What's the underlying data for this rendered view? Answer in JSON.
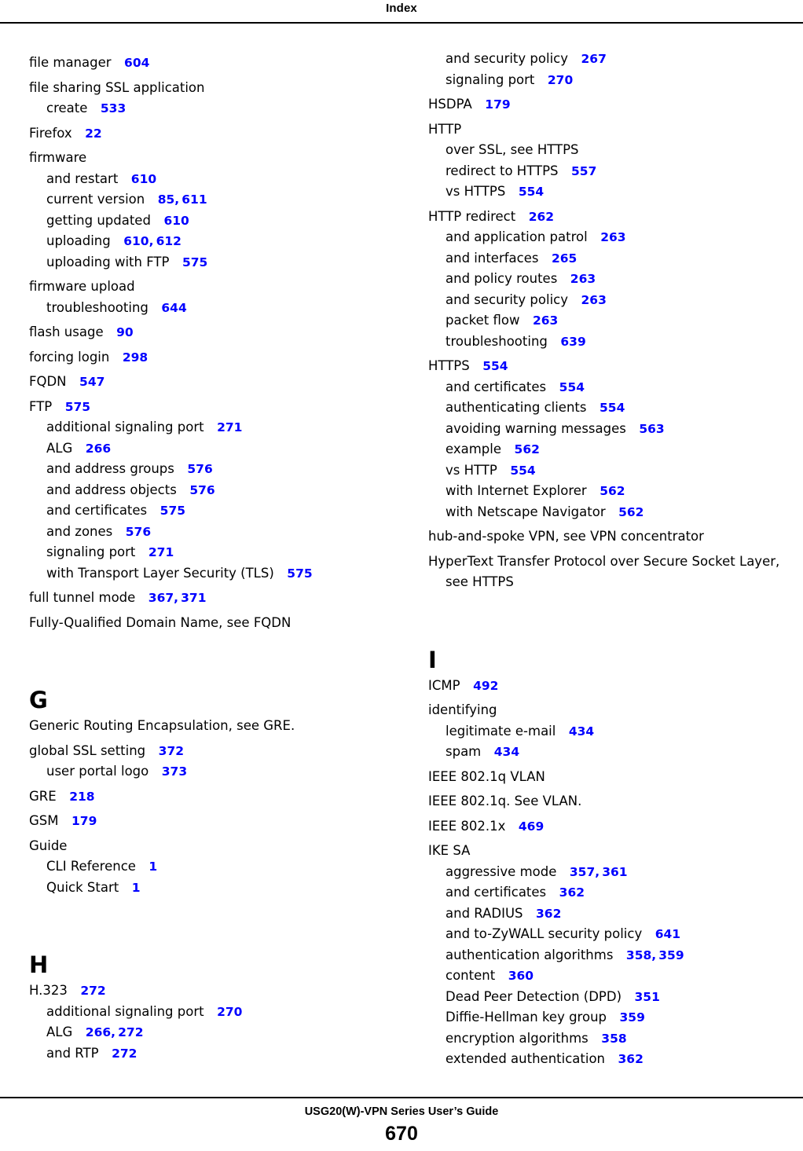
{
  "header": {
    "title": "Index"
  },
  "footer": {
    "guide_title": "USG20(W)-VPN Series User’s Guide",
    "page_number": "670"
  },
  "colors": {
    "page_ref": "#0000ff",
    "text": "#000000",
    "background": "#ffffff"
  },
  "columns": [
    {
      "name": "left-column",
      "blocks": [
        {
          "letter": null,
          "entries": [
            {
              "level": 0,
              "label": "file manager",
              "refs": [
                "604"
              ]
            },
            {
              "level": 0,
              "label": "file sharing SSL application",
              "refs": []
            },
            {
              "level": 1,
              "label": "create",
              "refs": [
                "533"
              ]
            },
            {
              "level": 0,
              "label": "Firefox",
              "refs": [
                "22"
              ]
            },
            {
              "level": 0,
              "label": "firmware",
              "refs": []
            },
            {
              "level": 1,
              "label": "and restart",
              "refs": [
                "610"
              ]
            },
            {
              "level": 1,
              "label": "current version",
              "refs": [
                "85",
                "611"
              ]
            },
            {
              "level": 1,
              "label": "getting updated",
              "refs": [
                "610"
              ]
            },
            {
              "level": 1,
              "label": "uploading",
              "refs": [
                "610",
                "612"
              ]
            },
            {
              "level": 1,
              "label": "uploading with FTP",
              "refs": [
                "575"
              ]
            },
            {
              "level": 0,
              "label": "firmware upload",
              "refs": []
            },
            {
              "level": 1,
              "label": "troubleshooting",
              "refs": [
                "644"
              ]
            },
            {
              "level": 0,
              "label": "flash usage",
              "refs": [
                "90"
              ]
            },
            {
              "level": 0,
              "label": "forcing login",
              "refs": [
                "298"
              ]
            },
            {
              "level": 0,
              "label": "FQDN",
              "refs": [
                "547"
              ]
            },
            {
              "level": 0,
              "label": "FTP",
              "refs": [
                "575"
              ]
            },
            {
              "level": 1,
              "label": "additional signaling port",
              "refs": [
                "271"
              ]
            },
            {
              "level": 1,
              "label": "ALG",
              "refs": [
                "266"
              ]
            },
            {
              "level": 1,
              "label": "and address groups",
              "refs": [
                "576"
              ]
            },
            {
              "level": 1,
              "label": "and address objects",
              "refs": [
                "576"
              ]
            },
            {
              "level": 1,
              "label": "and certificates",
              "refs": [
                "575"
              ]
            },
            {
              "level": 1,
              "label": "and zones",
              "refs": [
                "576"
              ]
            },
            {
              "level": 1,
              "label": "signaling port",
              "refs": [
                "271"
              ]
            },
            {
              "level": 1,
              "label": "with Transport Layer Security (TLS)",
              "refs": [
                "575"
              ]
            },
            {
              "level": 0,
              "label": "full tunnel mode",
              "refs": [
                "367",
                "371"
              ]
            },
            {
              "level": 0,
              "label": "Fully-Qualified Domain Name, see FQDN",
              "refs": []
            }
          ]
        },
        {
          "letter": "G",
          "entries": [
            {
              "level": 0,
              "label": "Generic Routing Encapsulation, see GRE.",
              "refs": []
            },
            {
              "level": 0,
              "label": "global SSL setting",
              "refs": [
                "372"
              ]
            },
            {
              "level": 1,
              "label": "user portal logo",
              "refs": [
                "373"
              ]
            },
            {
              "level": 0,
              "label": "GRE",
              "refs": [
                "218"
              ]
            },
            {
              "level": 0,
              "label": "GSM",
              "refs": [
                "179"
              ]
            },
            {
              "level": 0,
              "label": "Guide",
              "refs": []
            },
            {
              "level": 1,
              "label": "CLI Reference",
              "refs": [
                "1"
              ]
            },
            {
              "level": 1,
              "label": "Quick Start",
              "refs": [
                "1"
              ]
            }
          ]
        },
        {
          "letter": "H",
          "entries": [
            {
              "level": 0,
              "label": "H.323",
              "refs": [
                "272"
              ]
            },
            {
              "level": 1,
              "label": "additional signaling port",
              "refs": [
                "270"
              ]
            },
            {
              "level": 1,
              "label": "ALG",
              "refs": [
                "266",
                "272"
              ]
            },
            {
              "level": 1,
              "label": "and RTP",
              "refs": [
                "272"
              ]
            }
          ]
        }
      ]
    },
    {
      "name": "right-column",
      "blocks": [
        {
          "letter": null,
          "entries": [
            {
              "level": 1,
              "label": "and security policy",
              "refs": [
                "267"
              ]
            },
            {
              "level": 1,
              "label": "signaling port",
              "refs": [
                "270"
              ]
            },
            {
              "level": 0,
              "label": "HSDPA",
              "refs": [
                "179"
              ]
            },
            {
              "level": 0,
              "label": "HTTP",
              "refs": []
            },
            {
              "level": 1,
              "label": "over SSL, see HTTPS",
              "refs": []
            },
            {
              "level": 1,
              "label": "redirect to HTTPS",
              "refs": [
                "557"
              ]
            },
            {
              "level": 1,
              "label": "vs HTTPS",
              "refs": [
                "554"
              ]
            },
            {
              "level": 0,
              "label": "HTTP redirect",
              "refs": [
                "262"
              ]
            },
            {
              "level": 1,
              "label": "and application patrol",
              "refs": [
                "263"
              ]
            },
            {
              "level": 1,
              "label": "and interfaces",
              "refs": [
                "265"
              ]
            },
            {
              "level": 1,
              "label": "and policy routes",
              "refs": [
                "263"
              ]
            },
            {
              "level": 1,
              "label": "and security policy",
              "refs": [
                "263"
              ]
            },
            {
              "level": 1,
              "label": "packet flow",
              "refs": [
                "263"
              ]
            },
            {
              "level": 1,
              "label": "troubleshooting",
              "refs": [
                "639"
              ]
            },
            {
              "level": 0,
              "label": "HTTPS",
              "refs": [
                "554"
              ]
            },
            {
              "level": 1,
              "label": "and certificates",
              "refs": [
                "554"
              ]
            },
            {
              "level": 1,
              "label": "authenticating clients",
              "refs": [
                "554"
              ]
            },
            {
              "level": 1,
              "label": "avoiding warning messages",
              "refs": [
                "563"
              ]
            },
            {
              "level": 1,
              "label": "example",
              "refs": [
                "562"
              ]
            },
            {
              "level": 1,
              "label": "vs HTTP",
              "refs": [
                "554"
              ]
            },
            {
              "level": 1,
              "label": "with Internet Explorer",
              "refs": [
                "562"
              ]
            },
            {
              "level": 1,
              "label": "with Netscape Navigator",
              "refs": [
                "562"
              ]
            },
            {
              "level": 0,
              "label": "hub-and-spoke VPN, see VPN concentrator",
              "refs": []
            },
            {
              "level": 0,
              "label": "HyperText Transfer Protocol over Secure Socket Layer, see HTTPS",
              "refs": []
            }
          ]
        },
        {
          "letter": "I",
          "entries": [
            {
              "level": 0,
              "label": "ICMP",
              "refs": [
                "492"
              ]
            },
            {
              "level": 0,
              "label": "identifying",
              "refs": []
            },
            {
              "level": 1,
              "label": "legitimate e-mail",
              "refs": [
                "434"
              ]
            },
            {
              "level": 1,
              "label": "spam",
              "refs": [
                "434"
              ]
            },
            {
              "level": 0,
              "label": "IEEE 802.1q VLAN",
              "refs": []
            },
            {
              "level": 0,
              "label": "IEEE 802.1q. See VLAN.",
              "refs": []
            },
            {
              "level": 0,
              "label": "IEEE 802.1x",
              "refs": [
                "469"
              ]
            },
            {
              "level": 0,
              "label": "IKE SA",
              "refs": []
            },
            {
              "level": 1,
              "label": "aggressive mode",
              "refs": [
                "357",
                "361"
              ]
            },
            {
              "level": 1,
              "label": "and certificates",
              "refs": [
                "362"
              ]
            },
            {
              "level": 1,
              "label": "and RADIUS",
              "refs": [
                "362"
              ]
            },
            {
              "level": 1,
              "label": "and to-ZyWALL security policy",
              "refs": [
                "641"
              ]
            },
            {
              "level": 1,
              "label": "authentication algorithms",
              "refs": [
                "358",
                "359"
              ]
            },
            {
              "level": 1,
              "label": "content",
              "refs": [
                "360"
              ]
            },
            {
              "level": 1,
              "label": "Dead Peer Detection (DPD)",
              "refs": [
                "351"
              ]
            },
            {
              "level": 1,
              "label": "Diffie-Hellman key group",
              "refs": [
                "359"
              ]
            },
            {
              "level": 1,
              "label": "encryption algorithms",
              "refs": [
                "358"
              ]
            },
            {
              "level": 1,
              "label": "extended authentication",
              "refs": [
                "362"
              ]
            }
          ]
        }
      ]
    }
  ]
}
